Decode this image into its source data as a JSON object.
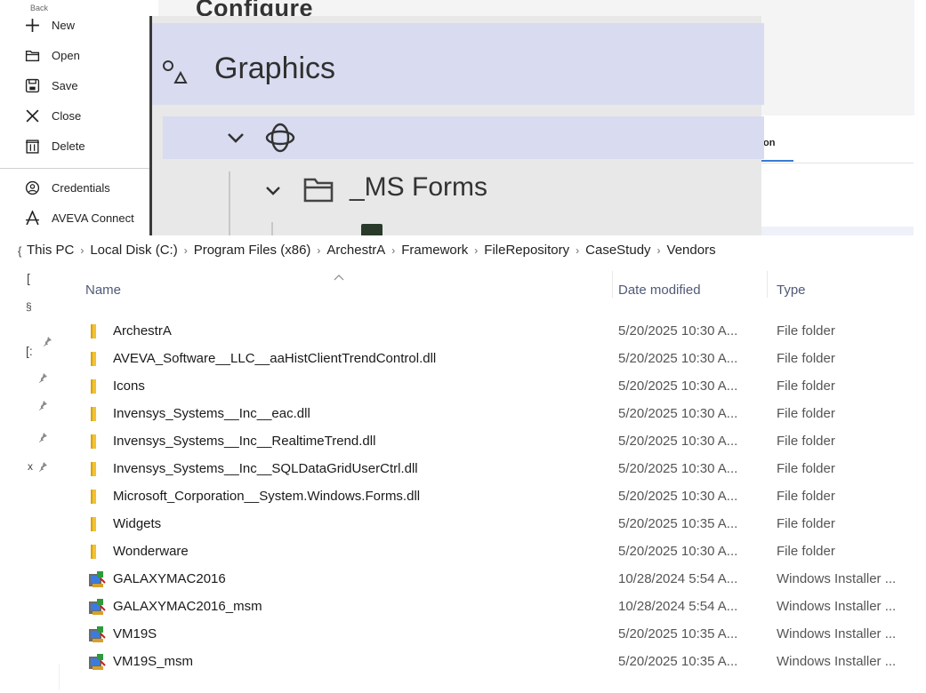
{
  "file_menu": {
    "back_label": "Back",
    "items": [
      {
        "label": "New",
        "icon": "plus-icon"
      },
      {
        "label": "Open",
        "icon": "folder-open-icon"
      },
      {
        "label": "Save",
        "icon": "save-icon"
      },
      {
        "label": "Close",
        "icon": "close-icon"
      },
      {
        "label": "Delete",
        "icon": "trash-icon"
      },
      {
        "label": "Credentials",
        "icon": "user-circle-icon"
      },
      {
        "label": "AVEVA Connect",
        "icon": "aveva-icon"
      }
    ]
  },
  "configure": {
    "title": "Configure",
    "tab_partial": "on"
  },
  "graphics_panel": {
    "title": "Graphics",
    "folder_label": "_MS Forms"
  },
  "explorer": {
    "breadcrumb": [
      "This PC",
      "Local Disk (C:)",
      "Program Files (x86)",
      "ArchestrA",
      "Framework",
      "FileRepository",
      "CaseStudy",
      "Vendors"
    ],
    "columns": {
      "name": "Name",
      "date": "Date modified",
      "type": "Type"
    },
    "files": [
      {
        "name": "ArchestrA",
        "date": "5/20/2025 10:30 A...",
        "type": "File folder",
        "icon": "folder-icon"
      },
      {
        "name": "AVEVA_Software__LLC__aaHistClientTrendControl.dll",
        "date": "5/20/2025 10:30 A...",
        "type": "File folder",
        "icon": "folder-icon"
      },
      {
        "name": "Icons",
        "date": "5/20/2025 10:30 A...",
        "type": "File folder",
        "icon": "folder-icon"
      },
      {
        "name": "Invensys_Systems__Inc__eac.dll",
        "date": "5/20/2025 10:30 A...",
        "type": "File folder",
        "icon": "folder-icon"
      },
      {
        "name": "Invensys_Systems__Inc__RealtimeTrend.dll",
        "date": "5/20/2025 10:30 A...",
        "type": "File folder",
        "icon": "folder-icon"
      },
      {
        "name": "Invensys_Systems__Inc__SQLDataGridUserCtrl.dll",
        "date": "5/20/2025 10:30 A...",
        "type": "File folder",
        "icon": "folder-icon"
      },
      {
        "name": "Microsoft_Corporation__System.Windows.Forms.dll",
        "date": "5/20/2025 10:30 A...",
        "type": "File folder",
        "icon": "folder-icon"
      },
      {
        "name": "Widgets",
        "date": "5/20/2025 10:35 A...",
        "type": "File folder",
        "icon": "folder-icon"
      },
      {
        "name": "Wonderware",
        "date": "5/20/2025 10:30 A...",
        "type": "File folder",
        "icon": "folder-icon"
      },
      {
        "name": "GALAXYMAC2016",
        "date": "10/28/2024 5:54 A...",
        "type": "Windows Installer ...",
        "icon": "installer-icon"
      },
      {
        "name": "GALAXYMAC2016_msm",
        "date": "10/28/2024 5:54 A...",
        "type": "Windows Installer ...",
        "icon": "installer-icon"
      },
      {
        "name": "VM19S",
        "date": "5/20/2025 10:35 A...",
        "type": "Windows Installer ...",
        "icon": "installer-icon"
      },
      {
        "name": "VM19S_msm",
        "date": "5/20/2025 10:35 A...",
        "type": "Windows Installer ...",
        "icon": "installer-icon"
      }
    ],
    "edge_fragments": [
      "{",
      "[",
      "§",
      "[:",
      "x"
    ]
  },
  "colors": {
    "header_band": "#d9dcf0",
    "folder_yellow": "#f2c230",
    "accent_blue": "#3a7bd5"
  }
}
